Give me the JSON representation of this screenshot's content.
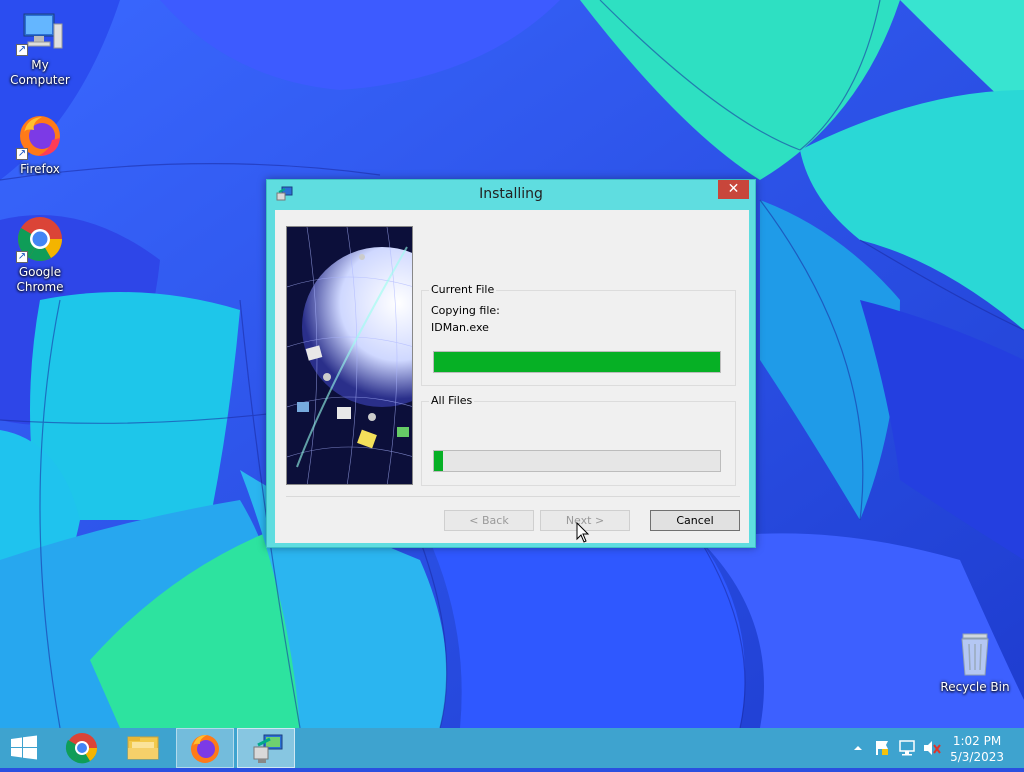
{
  "desktop": {
    "icons": [
      {
        "label": "My Computer",
        "icon": "computer-icon"
      },
      {
        "label": "Firefox",
        "icon": "firefox-icon"
      },
      {
        "label": "Google Chrome",
        "icon": "chrome-icon"
      },
      {
        "label": "Recycle Bin",
        "icon": "recycle-bin-icon"
      }
    ]
  },
  "dialog": {
    "title": "Installing",
    "close_label": "✕",
    "current_file": {
      "group_label": "Current File",
      "action_text": "Copying file:",
      "file_name": "IDMan.exe",
      "progress": 1.0
    },
    "all_files": {
      "group_label": "All Files",
      "progress": 0.03
    },
    "buttons": {
      "back": "< Back",
      "next": "Next >",
      "cancel": "Cancel"
    }
  },
  "taskbar": {
    "items": [
      "start-icon",
      "chrome-icon",
      "file-explorer-icon",
      "firefox-icon",
      "installer-icon"
    ],
    "clock": {
      "time": "1:02 PM",
      "date": "5/3/2023"
    },
    "tray": [
      "show-hidden-icons-icon",
      "action-center-flag-icon",
      "network-icon",
      "volume-muted-icon"
    ]
  },
  "colors": {
    "accent": "#5fdde0",
    "progress_fill": "#06b025",
    "close_button": "#c8463b",
    "taskbar": "#3ea3cf"
  }
}
